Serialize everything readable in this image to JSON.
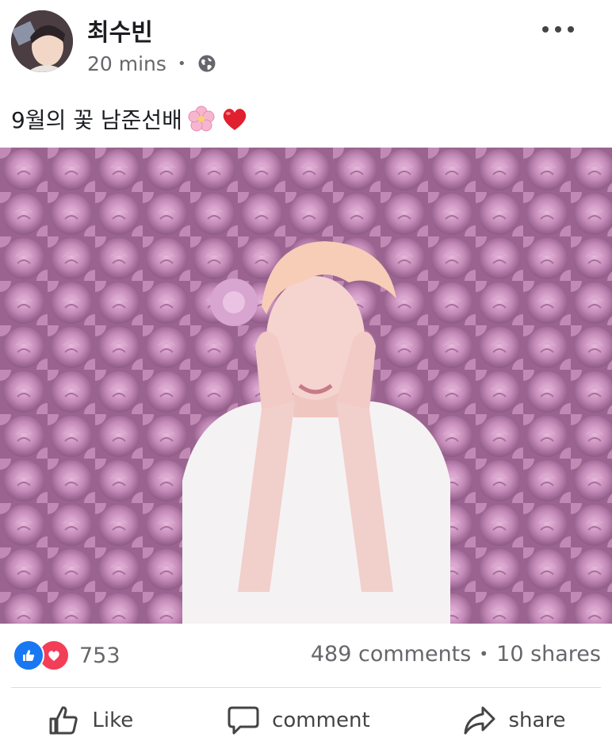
{
  "post": {
    "author": "최수빈",
    "time": "20 mins",
    "separator": "•",
    "audience_icon": "globe-icon",
    "more_icon": "more-options-icon",
    "caption": "9월의 꽃 남준선배",
    "caption_emojis": [
      "cherry-blossom-icon",
      "red-heart-icon"
    ]
  },
  "stats": {
    "reaction_icons": [
      "like-reaction-icon",
      "love-reaction-icon"
    ],
    "reaction_count": "753",
    "comments": "489 comments",
    "dot": "•",
    "shares": "10 shares"
  },
  "actions": [
    {
      "label": "Like",
      "icon": "thumbs-up-icon"
    },
    {
      "label": "comment",
      "icon": "speech-bubble-icon"
    },
    {
      "label": "share",
      "icon": "share-arrow-icon"
    }
  ],
  "colors": {
    "like_blue": "#1877f2",
    "love_red": "#f33e58",
    "meta_gray": "#65676b",
    "photo_pink": "#b27ea7"
  }
}
